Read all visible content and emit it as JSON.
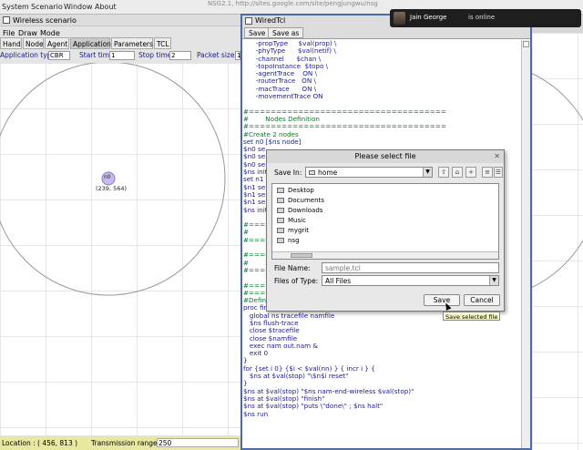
{
  "sysbar": {
    "menus": [
      "System",
      "Scenario",
      "Window",
      "About"
    ],
    "window_title": "NSG2.1, http://sites.google.com/site/pengjungwu/nsg"
  },
  "notification": {
    "name": "Jain George",
    "status": "is online"
  },
  "wireless_window": {
    "title": "Wireless scenario",
    "menu": [
      "File",
      "Draw",
      "Mode"
    ],
    "tabs": [
      "Hand",
      "Node",
      "Agent",
      "Application",
      "Parameters",
      "TCL"
    ],
    "active_tab": "Application",
    "app_type_label": "Application type",
    "app_type_value": "CBR",
    "start_time_label": "Start time",
    "start_time_value": "1",
    "stop_time_label": "Stop time",
    "stop_time_value": "2",
    "packet_size_label": "Packet size",
    "packet_size_value": "1",
    "node_label": "n0",
    "node_coords": "(239, 564)",
    "status_location": "Location : ( 456, 813 )",
    "status_range_label": "Transmission range",
    "status_range_value": "250"
  },
  "tcl_window": {
    "title": "WiredTcl",
    "save_label": "Save",
    "save_as_label": "Save as",
    "code_lines": [
      "      -propType     $val(prop) \\",
      "      -phyType      $val(netif) \\",
      "      -channel      $chan \\",
      "      -topoInstance  $topo \\",
      "      -agentTrace    ON \\",
      "      -routerTrace   ON \\",
      "      -macTrace      ON \\",
      "      -movementTrace ON",
      "",
      "#====================================",
      "#        Nodes Definition",
      "#====================================",
      "#Create 2 nodes",
      "set n0 [$ns node]",
      "$n0 se",
      "$n0 se",
      "$n0 se",
      "$ns init",
      "set n1",
      "$n1 se",
      "$n1 se",
      "$n1 se",
      "$ns init",
      "",
      "#=====",
      "#",
      "#=====",
      "",
      "#=====",
      "#",
      "#=====",
      "",
      "#=====",
      "#=====",
      "#Define a 'finish' procedure",
      "proc finish {} {",
      "   global ns tracefile namfile",
      "   $ns flush-trace",
      "   close $tracefile",
      "   close $namfile",
      "   exec nam out.nam &",
      "   exit 0",
      "}",
      "for {set i 0} {$i < $val(nn) } { incr i } {",
      "   $ns at $val(stop) \"\\$n$i reset\"",
      "}",
      "$ns at $val(stop) \"$ns nam-end-wireless $val(stop)\"",
      "$ns at $val(stop) \"finish\"",
      "$ns at $val(stop) \"puts \\\"done\\\" ; $ns halt\"",
      "$ns run"
    ]
  },
  "dialog": {
    "title": "Please select file",
    "save_in_label": "Save In:",
    "save_in_value": "home",
    "files": [
      "Desktop",
      "Documents",
      "Downloads",
      "Music",
      "mygrit",
      "nsg"
    ],
    "file_name_label": "File Name:",
    "file_name_value": "sample.tcl",
    "file_type_label": "Files of Type:",
    "file_type_value": "All Files",
    "save_button": "Save",
    "cancel_button": "Cancel",
    "tooltip": "Save selected file"
  },
  "colors": {
    "accent_border": "#4a6aa8",
    "comment_green": "#0a7a2a",
    "code_blue": "#1a1a9a",
    "status_yellow": "#e8e8a0",
    "node_fill": "#c8b8f0"
  }
}
